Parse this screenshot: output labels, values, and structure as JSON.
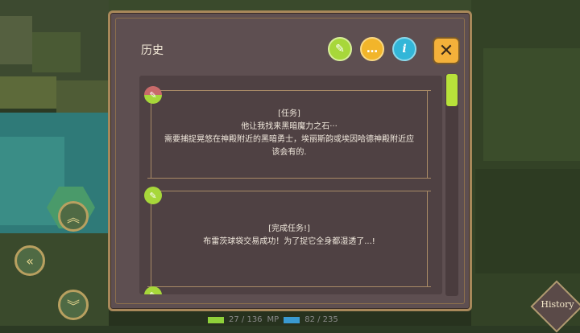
{
  "dialog": {
    "title": "历史",
    "close_symbol": "✕",
    "icons": {
      "quest": "quest-scroll-icon",
      "chat": "chat-bubble-icon",
      "info": "info-icon",
      "info_glyph": "i",
      "chat_glyph": "…"
    }
  },
  "entries": [
    {
      "badge": "quest-flag-icon",
      "lines": [
        "[任务]",
        "他让我找来黑暗魔力之石···",
        "需要捕捉晃悠在神殿附近的黑暗勇士，埃丽斯韵或埃因哈德神殿附近应",
        "该会有的."
      ]
    },
    {
      "badge": "quest-complete-icon",
      "lines": [
        "[完成任务!]",
        "布雷茨球袋交易成功！为了捉它全身都湿透了...!"
      ]
    }
  ],
  "status": {
    "hp_text": "27 / 136",
    "mp_label": "MP",
    "mp_text": "82 / 235"
  },
  "history_button": {
    "label": "History"
  }
}
